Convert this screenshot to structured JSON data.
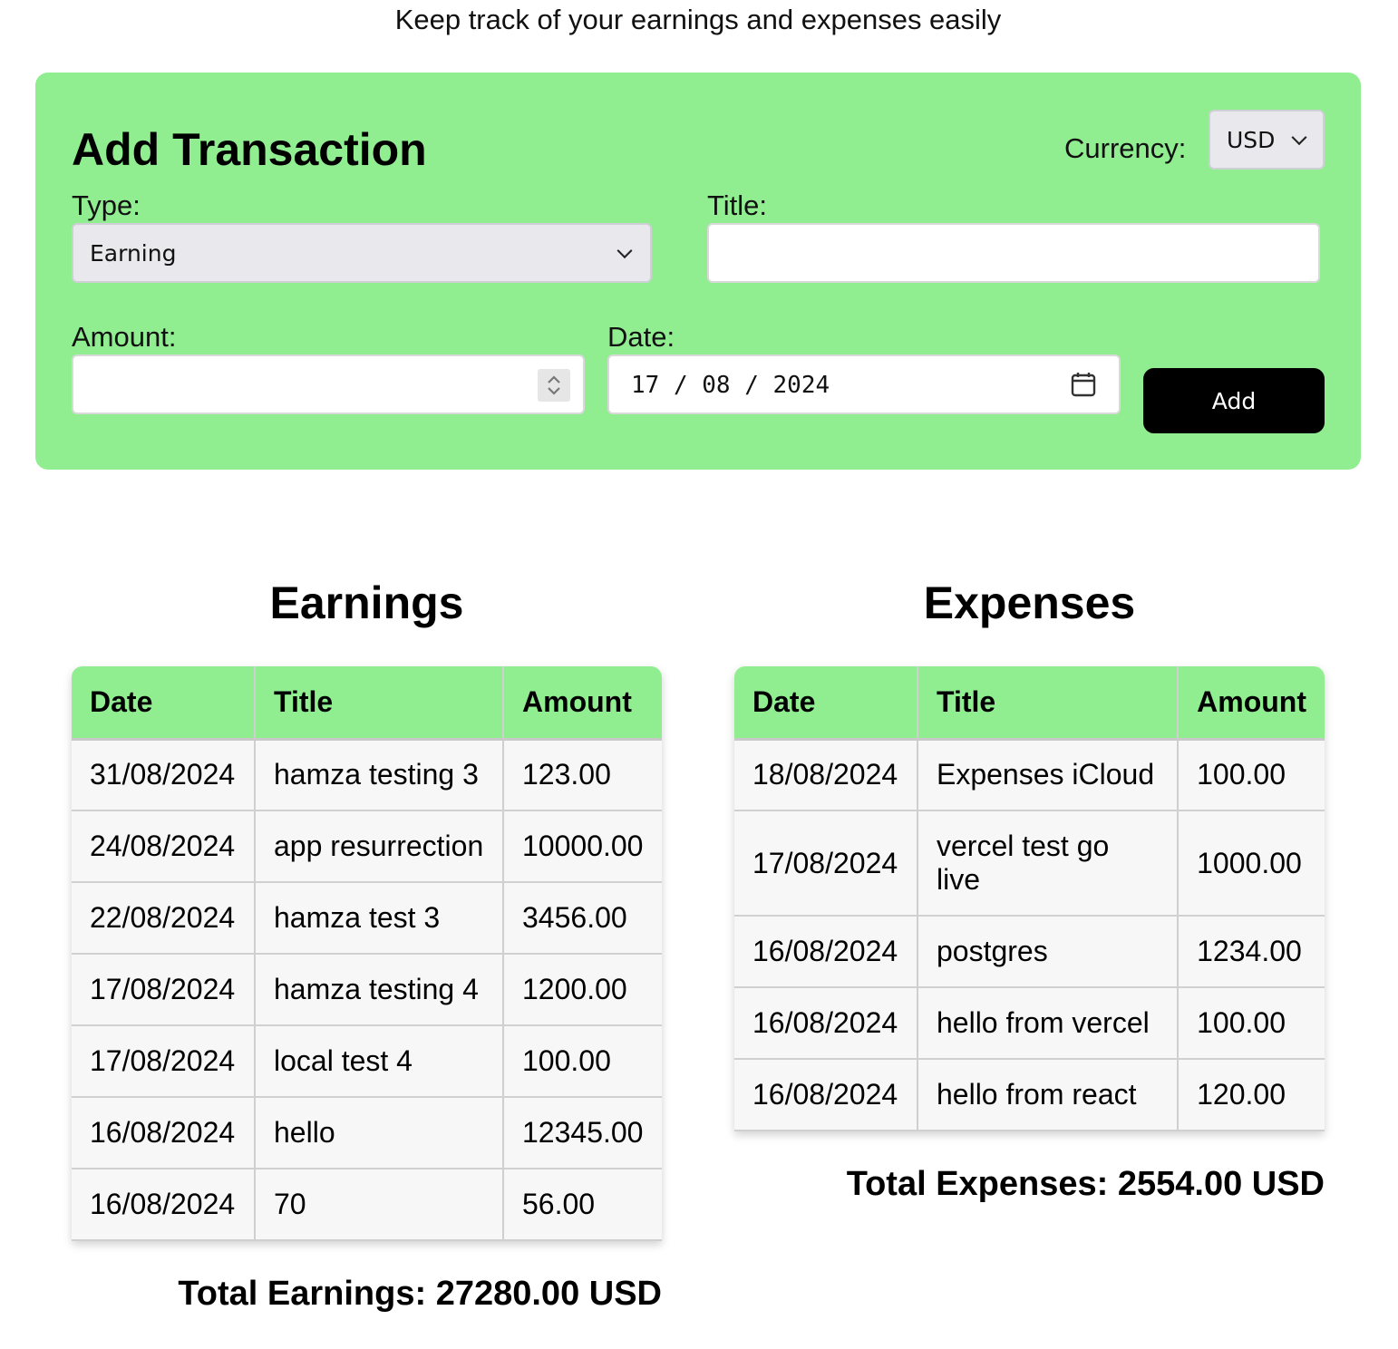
{
  "header": {
    "subtitle": "Keep track of your earnings and expenses easily"
  },
  "form": {
    "title": "Add Transaction",
    "currency_label": "Currency:",
    "currency_value": "USD",
    "type_label": "Type:",
    "type_value": "Earning",
    "title_label": "Title:",
    "title_value": "",
    "amount_label": "Amount:",
    "amount_value": "",
    "date_label": "Date:",
    "date_value": "17 / 08 / 2024",
    "add_label": "Add"
  },
  "earnings": {
    "heading": "Earnings",
    "columns": [
      "Date",
      "Title",
      "Amount"
    ],
    "rows": [
      [
        "31/08/2024",
        "hamza testing 3",
        "123.00"
      ],
      [
        "24/08/2024",
        "app resurrection",
        "10000.00"
      ],
      [
        "22/08/2024",
        "hamza test 3",
        "3456.00"
      ],
      [
        "17/08/2024",
        "hamza testing 4",
        "1200.00"
      ],
      [
        "17/08/2024",
        "local test 4",
        "100.00"
      ],
      [
        "16/08/2024",
        "hello",
        "12345.00"
      ],
      [
        "16/08/2024",
        "70",
        "56.00"
      ]
    ],
    "total": "Total Earnings: 27280.00 USD"
  },
  "expenses": {
    "heading": "Expenses",
    "columns": [
      "Date",
      "Title",
      "Amount"
    ],
    "rows": [
      [
        "18/08/2024",
        "Expenses iCloud",
        "100.00"
      ],
      [
        "17/08/2024",
        "vercel test go live",
        "1000.00"
      ],
      [
        "16/08/2024",
        "postgres",
        "1234.00"
      ],
      [
        "16/08/2024",
        "hello from vercel",
        "100.00"
      ],
      [
        "16/08/2024",
        "hello from react",
        "120.00"
      ]
    ],
    "total": "Total Expenses: 2554.00 USD"
  },
  "colors": {
    "accent": "#90ee90",
    "button": "#000000"
  },
  "icons": [
    "chevron-down-icon",
    "spinner-icon",
    "calendar-icon"
  ]
}
